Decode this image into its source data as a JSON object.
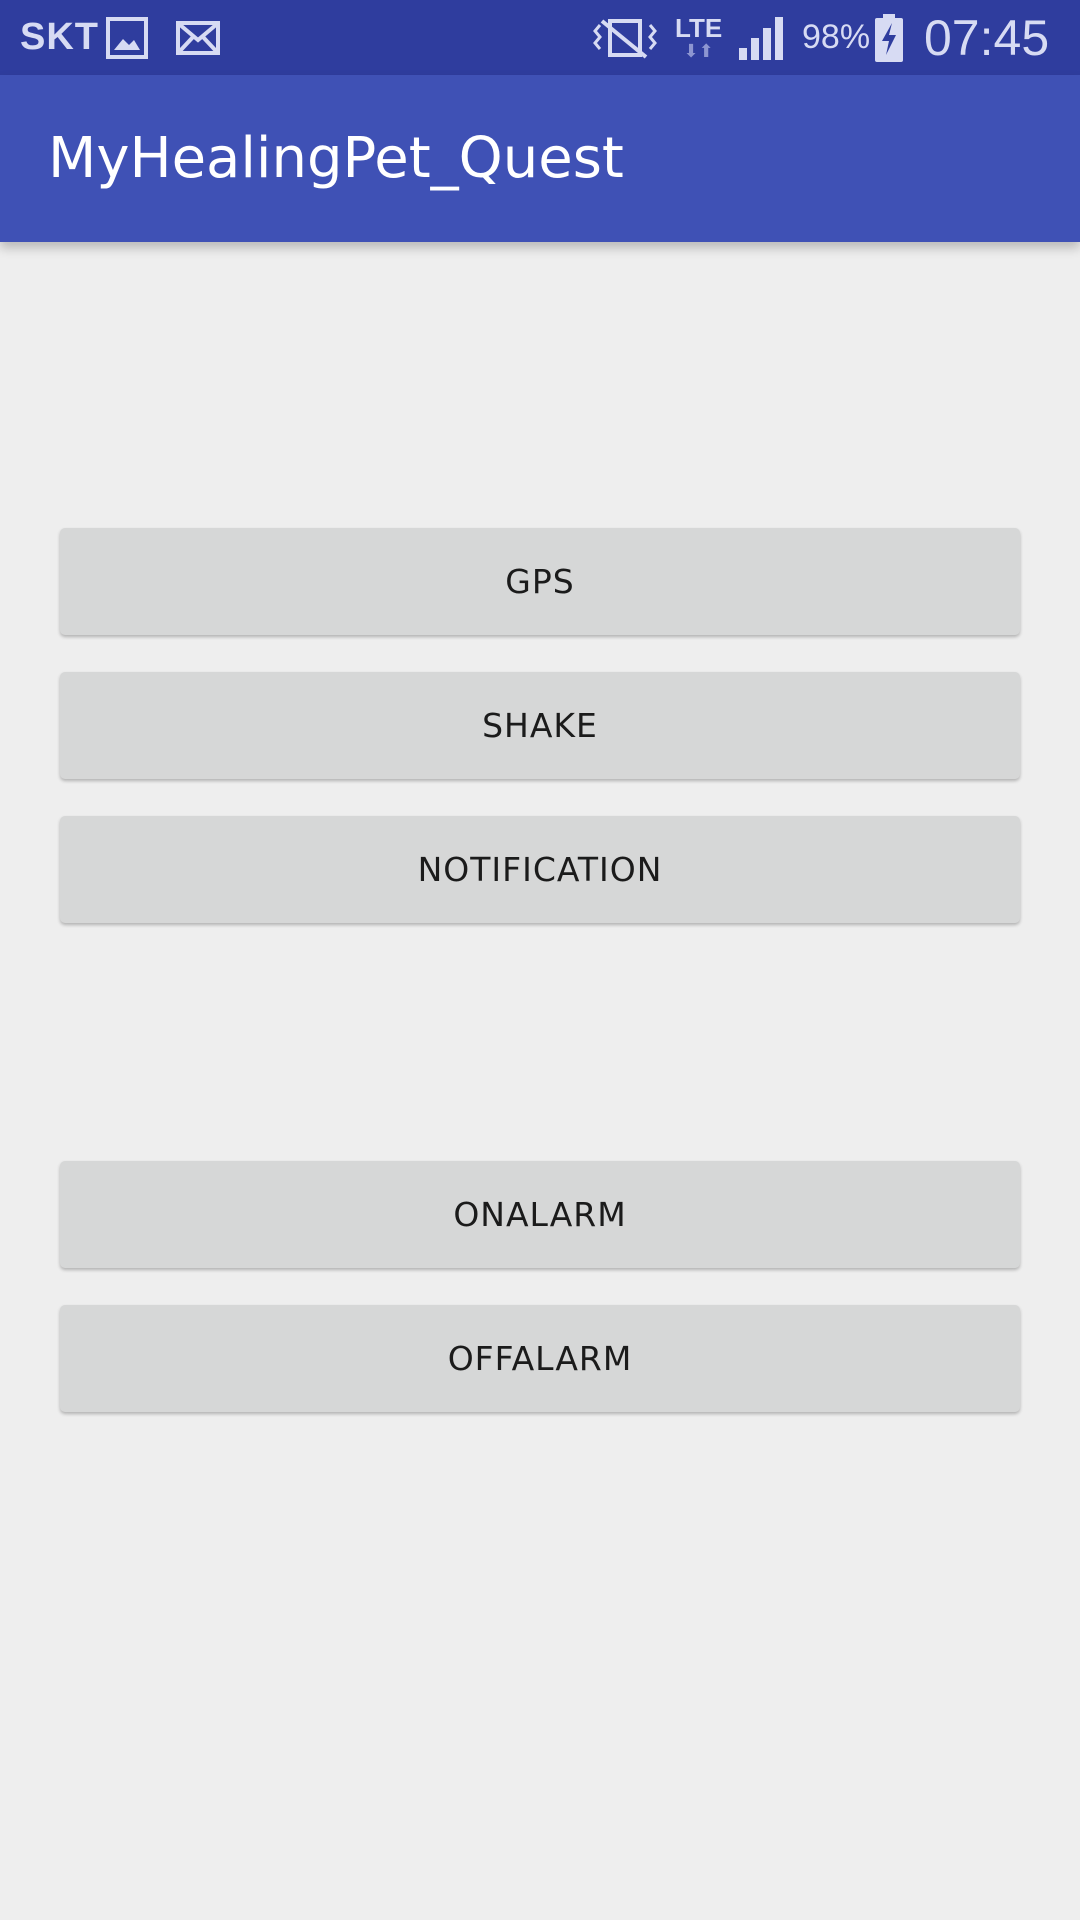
{
  "status_bar": {
    "carrier": "SKT",
    "network": "LTE",
    "battery_percent": "98%",
    "time": "07:45",
    "icons": [
      "gallery-icon",
      "mail-icon",
      "vibrate-mute-icon",
      "data-arrows-icon",
      "signal-icon",
      "battery-charging-icon"
    ]
  },
  "app_bar": {
    "title": "MyHealingPet_Quest"
  },
  "buttons": {
    "gps": "GPS",
    "shake": "SHAKE",
    "notification": "NOTIFICATION",
    "onalarm": "ONALARM",
    "offalarm": "OFFALARM"
  },
  "colors": {
    "status_bar": "#2f3d9e",
    "app_bar": "#3f51b5",
    "background": "#eeeeee",
    "button": "#d6d7d7"
  }
}
